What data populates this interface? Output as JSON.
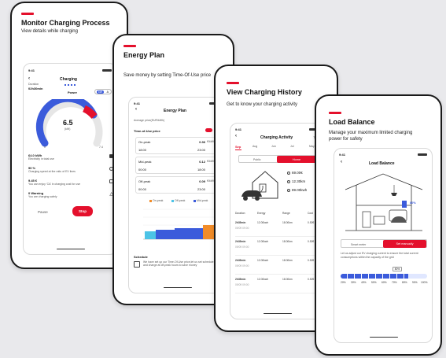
{
  "cards": [
    {
      "title": "Monitor Charging Process",
      "subtitle": "View details while charging"
    },
    {
      "title": "Energy Plan",
      "subtitle": "Save money by setting Time-Of-Use price"
    },
    {
      "title": "View Charging History",
      "subtitle": "Get to know your charging activity"
    },
    {
      "title": "Load Balance",
      "subtitle_line1": "Manage your maximum limited charging",
      "subtitle_line2": "power for safety"
    }
  ],
  "monitor": {
    "time": "9:41",
    "screen_title": "Charging",
    "duration_label": "Duration",
    "duration": "02h30min",
    "mode_label": "Power",
    "mode_a": "kW",
    "mode_b": "A",
    "gauge_value": "6.5",
    "gauge_unit": "(kW)",
    "gauge_min": "0",
    "gauge_max": "7.4",
    "stats": [
      {
        "value": "64.0 kWh",
        "desc": "Electricity in total use"
      },
      {
        "value": "90 %",
        "desc": "Charging speed at the ratio of EV lines"
      },
      {
        "value": "9.45 €",
        "desc": "You can enjoy ‘CA’ in charging cost for use"
      },
      {
        "value": "0 Warning",
        "desc": "You are charging safely"
      }
    ],
    "pause": "Pause",
    "stop": "Stop"
  },
  "energy": {
    "time": "9:41",
    "screen_title": "Energy Plan",
    "avg_label": "Average price(EUR/kWh)",
    "edit": "Edit",
    "tou_label": "Time-of-Use price",
    "periods": [
      {
        "name": "On-peak",
        "price": "0.36",
        "unit": "€/kWh",
        "start": "18:00",
        "end": "23:00"
      },
      {
        "name": "Mid-peak",
        "price": "0.12",
        "unit": "€/kWh",
        "start": "00:00",
        "end": "18:00"
      },
      {
        "name": "Off-peak",
        "price": "0.09",
        "unit": "€/kWh",
        "start": "00:00",
        "end": "23:00"
      }
    ],
    "legend": [
      "On-peak",
      "Off-peak",
      "Mid-peak"
    ],
    "schedule_title": "Schedule",
    "schedule_text": "We have set up our Time-Of-Use price,let us set schedule and charge at off-peak hours to save money"
  },
  "history": {
    "time": "9:41",
    "screen_title": "Charging Activity",
    "trends": "Trends",
    "months": [
      "Sep",
      "Aug",
      "Jun",
      "Jul",
      "May"
    ],
    "seg_a": "Public",
    "seg_b": "Home",
    "totals": [
      "69.00€",
      "12.30km",
      "89.00kwh"
    ],
    "headers": [
      "Duration",
      "Energy",
      "Range",
      "Cost"
    ],
    "rows": [
      {
        "dur": "2h35min",
        "energy": "12.00kwh",
        "range": "18.00km",
        "cost": "0.52€",
        "date": "09/09 09:00"
      },
      {
        "dur": "2h35min",
        "energy": "12.00kwh",
        "range": "18.00km",
        "cost": "0.52€",
        "date": "09/09 09:00"
      },
      {
        "dur": "2h35min",
        "energy": "12.00kwh",
        "range": "18.00km",
        "cost": "0.52€",
        "date": "09/09 09:00"
      },
      {
        "dur": "2h35min",
        "energy": "12.00kwh",
        "range": "18.00km",
        "cost": "0.52€",
        "date": "09/09 09:00"
      }
    ]
  },
  "load": {
    "time": "9:41",
    "screen_title": "Load Balance",
    "pct": "80%",
    "opt_a": "Smart meter",
    "opt_b": "Set manually",
    "desc": "Let us adjust our EV charging current to ensure the total current consumptions within the capacity of the grid",
    "slider_value": "80%",
    "slider_ticks": [
      "20%",
      "30%",
      "40%",
      "50%",
      "60%",
      "70%",
      "80%",
      "90%",
      "100%"
    ]
  }
}
